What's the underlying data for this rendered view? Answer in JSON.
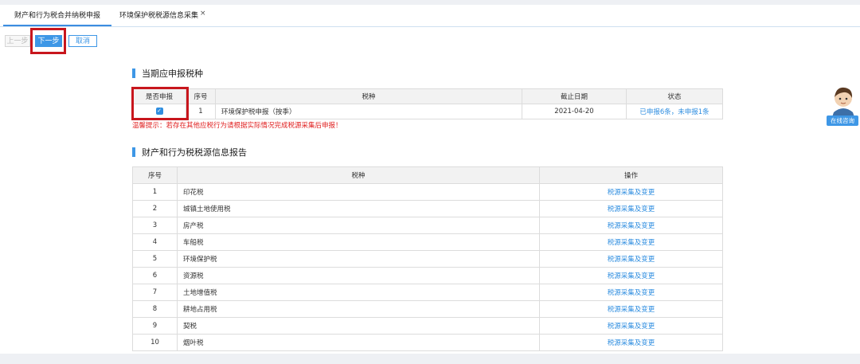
{
  "tabs": [
    {
      "label": "财产和行为税合并纳税申报"
    },
    {
      "label": "环境保护税税源信息采集",
      "close": "×"
    }
  ],
  "toolbar": {
    "prev_label": "上一步",
    "next_label": "下一步",
    "cancel_label": "取消"
  },
  "current_tax": {
    "title": "当期应申报税种",
    "headers": [
      "是否申报",
      "序号",
      "税种",
      "截止日期",
      "状态"
    ],
    "rows": [
      {
        "checked": true,
        "index": "1",
        "tax": "环境保护税申报（按季）",
        "deadline": "2021-04-20",
        "status": "已申报6条，未申报1条"
      }
    ],
    "tip": "温馨提示：若存在其他应税行为请根据实际情况完成税源采集后申报！"
  },
  "report": {
    "title": "财产和行为税税源信息报告",
    "headers": [
      "序号",
      "税种",
      "操作"
    ],
    "rows": [
      {
        "index": "1",
        "tax": "印花税",
        "action": "税源采集及变更"
      },
      {
        "index": "2",
        "tax": "城镇土地使用税",
        "action": "税源采集及变更"
      },
      {
        "index": "3",
        "tax": "房产税",
        "action": "税源采集及变更"
      },
      {
        "index": "4",
        "tax": "车船税",
        "action": "税源采集及变更"
      },
      {
        "index": "5",
        "tax": "环境保护税",
        "action": "税源采集及变更"
      },
      {
        "index": "6",
        "tax": "资源税",
        "action": "税源采集及变更"
      },
      {
        "index": "7",
        "tax": "土地增值税",
        "action": "税源采集及变更"
      },
      {
        "index": "8",
        "tax": "耕地占用税",
        "action": "税源采集及变更"
      },
      {
        "index": "9",
        "tax": "契税",
        "action": "税源采集及变更"
      },
      {
        "index": "10",
        "tax": "烟叶税",
        "action": "税源采集及变更"
      }
    ]
  },
  "help": {
    "label": "在线咨询"
  },
  "colors": {
    "accent": "#3e97e6",
    "highlight": "#c8161d",
    "warning": "#e02020"
  }
}
